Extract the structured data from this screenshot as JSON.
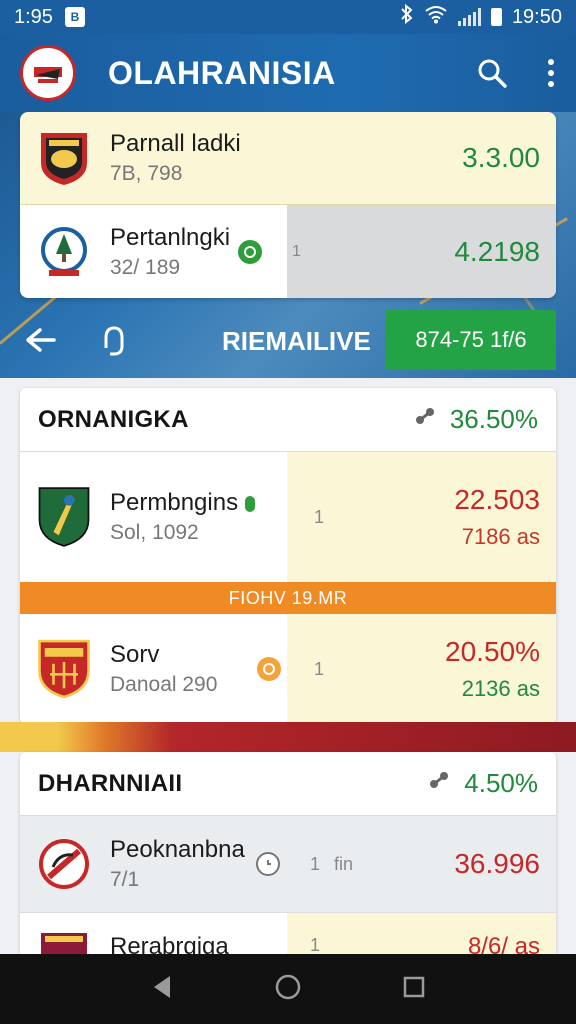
{
  "status_bar": {
    "time": "1:95",
    "notif_icon_text": "B",
    "clock": "19:50"
  },
  "app_bar": {
    "title": "OLAHRANISIA"
  },
  "hero": {
    "matches": [
      {
        "team": "Parnall ladki",
        "sub": "7B, 798",
        "score": "3.3.00"
      },
      {
        "team": "Pertanlngki",
        "sub": "32/ 189",
        "mid": "1",
        "score": "4.2198"
      }
    ],
    "live_label": "RIEMAILIVE",
    "live_odds": "874-75 1f/6"
  },
  "section1": {
    "title": "ORNANIGKA",
    "percent": "36.50%",
    "rows": [
      {
        "team": "Permbngins",
        "sub": "Sol, 1092",
        "mid": "1",
        "score": "22.503",
        "score_sub": "7186 as"
      },
      {
        "team": "Sorv",
        "sub": "Danoal 290",
        "mid": "1",
        "score": "20.50%",
        "score_sub": "2136 as"
      }
    ],
    "promo": "FIOHV 19.MR"
  },
  "section2": {
    "title": "DHARNNIAII",
    "percent": "4.50%",
    "rows": [
      {
        "team": "Peoknanbna",
        "sub": "7/1",
        "mid": "1",
        "mid2": "fin",
        "score": "36.996"
      },
      {
        "team": "Rerabrgiga",
        "mid": "1",
        "score": "8/6/ as"
      }
    ]
  },
  "colors": {
    "primary": "#1b5fa0",
    "green": "#1f8a3c",
    "red": "#c62828",
    "orange": "#f08a24",
    "cream": "#fbf6d6"
  }
}
